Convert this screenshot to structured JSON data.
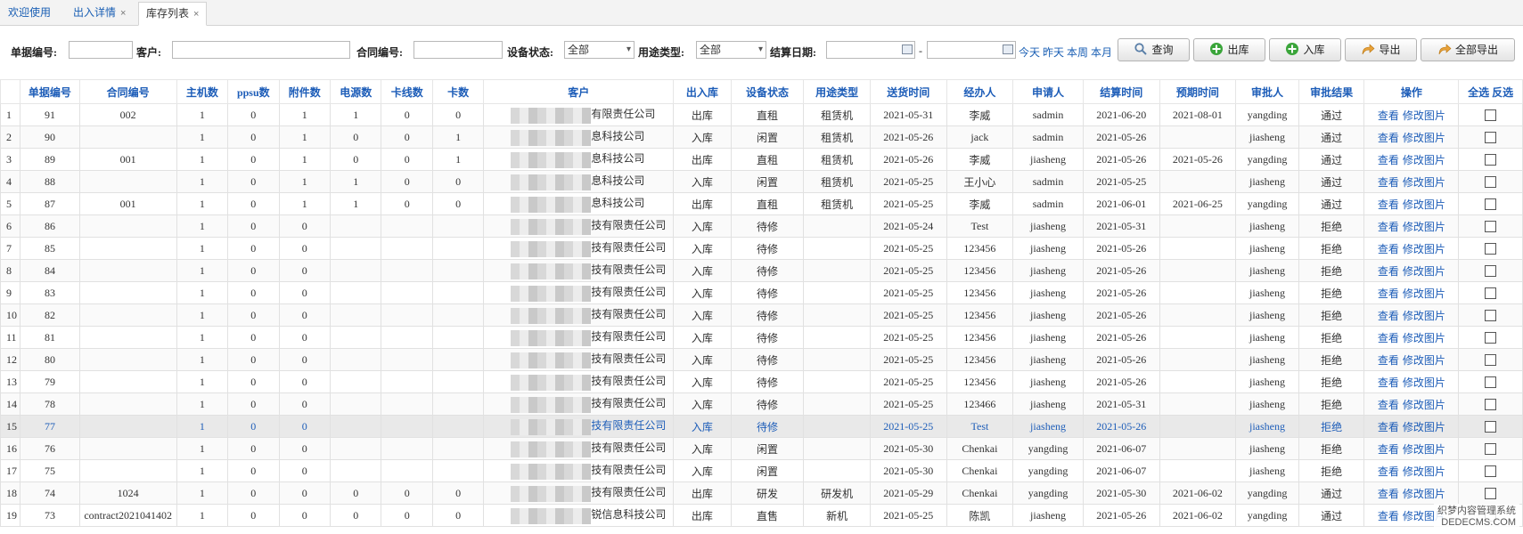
{
  "tabs": [
    {
      "label": "欢迎使用",
      "closable": false
    },
    {
      "label": "出入详情",
      "closable": true
    },
    {
      "label": "库存列表",
      "closable": true,
      "active": true
    }
  ],
  "filters": {
    "doc_no_label": "单据编号:",
    "customer_label": "客户:",
    "contract_no_label": "合同编号:",
    "device_status_label": "设备状态:",
    "device_status_value": "全部",
    "usage_type_label": "用途类型:",
    "usage_type_value": "全部",
    "settle_date_label": "结算日期:",
    "date_sep": "-",
    "quick_today": "今天",
    "quick_yesterday": "昨天",
    "quick_week": "本周",
    "quick_month": "本月"
  },
  "buttons": {
    "query": "查询",
    "outbound": "出库",
    "inbound": "入库",
    "export": "导出",
    "export_all": "全部导出"
  },
  "table": {
    "headers": [
      "单据编号",
      "合同编号",
      "主机数",
      "ppsu数",
      "附件数",
      "电源数",
      "卡线数",
      "卡数",
      "客户",
      "出入库",
      "设备状态",
      "用途类型",
      "送货时间",
      "经办人",
      "申请人",
      "结算时间",
      "预期时间",
      "审批人",
      "审批结果",
      "操作"
    ],
    "select_all": "全选",
    "invert": "反选",
    "view_label": "查看",
    "edit_image_label": "修改图片",
    "rows": [
      {
        "idx": "1",
        "doc": "91",
        "contract": "002",
        "host": "1",
        "ppsu": "0",
        "attach": "1",
        "power": "1",
        "cardline": "0",
        "card": "0",
        "customer": "有限责任公司",
        "io": "出库",
        "status": "直租",
        "usage": "租赁机",
        "delivery": "2021-05-31",
        "handler": "李威",
        "applicant": "sadmin",
        "settle": "2021-06-20",
        "expect": "2021-08-01",
        "approver": "yangding",
        "result": "通过"
      },
      {
        "idx": "2",
        "doc": "90",
        "contract": "",
        "host": "1",
        "ppsu": "0",
        "attach": "1",
        "power": "0",
        "cardline": "0",
        "card": "1",
        "customer": "息科技公司",
        "io": "入库",
        "status": "闲置",
        "usage": "租赁机",
        "delivery": "2021-05-26",
        "handler": "jack",
        "applicant": "sadmin",
        "settle": "2021-05-26",
        "expect": "",
        "approver": "jiasheng",
        "result": "通过"
      },
      {
        "idx": "3",
        "doc": "89",
        "contract": "001",
        "host": "1",
        "ppsu": "0",
        "attach": "1",
        "power": "0",
        "cardline": "0",
        "card": "1",
        "customer": "息科技公司",
        "io": "出库",
        "status": "直租",
        "usage": "租赁机",
        "delivery": "2021-05-26",
        "handler": "李威",
        "applicant": "jiasheng",
        "settle": "2021-05-26",
        "expect": "2021-05-26",
        "approver": "yangding",
        "result": "通过"
      },
      {
        "idx": "4",
        "doc": "88",
        "contract": "",
        "host": "1",
        "ppsu": "0",
        "attach": "1",
        "power": "1",
        "cardline": "0",
        "card": "0",
        "customer": "息科技公司",
        "io": "入库",
        "status": "闲置",
        "usage": "租赁机",
        "delivery": "2021-05-25",
        "handler": "王小心",
        "applicant": "sadmin",
        "settle": "2021-05-25",
        "expect": "",
        "approver": "jiasheng",
        "result": "通过"
      },
      {
        "idx": "5",
        "doc": "87",
        "contract": "001",
        "host": "1",
        "ppsu": "0",
        "attach": "1",
        "power": "1",
        "cardline": "0",
        "card": "0",
        "customer": "息科技公司",
        "io": "出库",
        "status": "直租",
        "usage": "租赁机",
        "delivery": "2021-05-25",
        "handler": "李威",
        "applicant": "sadmin",
        "settle": "2021-06-01",
        "expect": "2021-06-25",
        "approver": "yangding",
        "result": "通过"
      },
      {
        "idx": "6",
        "doc": "86",
        "contract": "",
        "host": "1",
        "ppsu": "0",
        "attach": "0",
        "power": "",
        "cardline": "",
        "card": "",
        "customer": "技有限责任公司",
        "io": "入库",
        "status": "待修",
        "usage": "",
        "delivery": "2021-05-24",
        "handler": "Test",
        "applicant": "jiasheng",
        "settle": "2021-05-31",
        "expect": "",
        "approver": "jiasheng",
        "result": "拒绝"
      },
      {
        "idx": "7",
        "doc": "85",
        "contract": "",
        "host": "1",
        "ppsu": "0",
        "attach": "0",
        "power": "",
        "cardline": "",
        "card": "",
        "customer": "技有限责任公司",
        "io": "入库",
        "status": "待修",
        "usage": "",
        "delivery": "2021-05-25",
        "handler": "123456",
        "applicant": "jiasheng",
        "settle": "2021-05-26",
        "expect": "",
        "approver": "jiasheng",
        "result": "拒绝"
      },
      {
        "idx": "8",
        "doc": "84",
        "contract": "",
        "host": "1",
        "ppsu": "0",
        "attach": "0",
        "power": "",
        "cardline": "",
        "card": "",
        "customer": "技有限责任公司",
        "io": "入库",
        "status": "待修",
        "usage": "",
        "delivery": "2021-05-25",
        "handler": "123456",
        "applicant": "jiasheng",
        "settle": "2021-05-26",
        "expect": "",
        "approver": "jiasheng",
        "result": "拒绝"
      },
      {
        "idx": "9",
        "doc": "83",
        "contract": "",
        "host": "1",
        "ppsu": "0",
        "attach": "0",
        "power": "",
        "cardline": "",
        "card": "",
        "customer": "技有限责任公司",
        "io": "入库",
        "status": "待修",
        "usage": "",
        "delivery": "2021-05-25",
        "handler": "123456",
        "applicant": "jiasheng",
        "settle": "2021-05-26",
        "expect": "",
        "approver": "jiasheng",
        "result": "拒绝"
      },
      {
        "idx": "10",
        "doc": "82",
        "contract": "",
        "host": "1",
        "ppsu": "0",
        "attach": "0",
        "power": "",
        "cardline": "",
        "card": "",
        "customer": "技有限责任公司",
        "io": "入库",
        "status": "待修",
        "usage": "",
        "delivery": "2021-05-25",
        "handler": "123456",
        "applicant": "jiasheng",
        "settle": "2021-05-26",
        "expect": "",
        "approver": "jiasheng",
        "result": "拒绝"
      },
      {
        "idx": "11",
        "doc": "81",
        "contract": "",
        "host": "1",
        "ppsu": "0",
        "attach": "0",
        "power": "",
        "cardline": "",
        "card": "",
        "customer": "技有限责任公司",
        "io": "入库",
        "status": "待修",
        "usage": "",
        "delivery": "2021-05-25",
        "handler": "123456",
        "applicant": "jiasheng",
        "settle": "2021-05-26",
        "expect": "",
        "approver": "jiasheng",
        "result": "拒绝"
      },
      {
        "idx": "12",
        "doc": "80",
        "contract": "",
        "host": "1",
        "ppsu": "0",
        "attach": "0",
        "power": "",
        "cardline": "",
        "card": "",
        "customer": "技有限责任公司",
        "io": "入库",
        "status": "待修",
        "usage": "",
        "delivery": "2021-05-25",
        "handler": "123456",
        "applicant": "jiasheng",
        "settle": "2021-05-26",
        "expect": "",
        "approver": "jiasheng",
        "result": "拒绝"
      },
      {
        "idx": "13",
        "doc": "79",
        "contract": "",
        "host": "1",
        "ppsu": "0",
        "attach": "0",
        "power": "",
        "cardline": "",
        "card": "",
        "customer": "技有限责任公司",
        "io": "入库",
        "status": "待修",
        "usage": "",
        "delivery": "2021-05-25",
        "handler": "123456",
        "applicant": "jiasheng",
        "settle": "2021-05-26",
        "expect": "",
        "approver": "jiasheng",
        "result": "拒绝"
      },
      {
        "idx": "14",
        "doc": "78",
        "contract": "",
        "host": "1",
        "ppsu": "0",
        "attach": "0",
        "power": "",
        "cardline": "",
        "card": "",
        "customer": "技有限责任公司",
        "io": "入库",
        "status": "待修",
        "usage": "",
        "delivery": "2021-05-25",
        "handler": "123466",
        "applicant": "jiasheng",
        "settle": "2021-05-31",
        "expect": "",
        "approver": "jiasheng",
        "result": "拒绝"
      },
      {
        "idx": "15",
        "doc": "77",
        "contract": "",
        "host": "1",
        "ppsu": "0",
        "attach": "0",
        "power": "",
        "cardline": "",
        "card": "",
        "customer": "技有限责任公司",
        "io": "入库",
        "status": "待修",
        "usage": "",
        "delivery": "2021-05-25",
        "handler": "Test",
        "applicant": "jiasheng",
        "settle": "2021-05-26",
        "expect": "",
        "approver": "jiasheng",
        "result": "拒绝",
        "selected": true
      },
      {
        "idx": "16",
        "doc": "76",
        "contract": "",
        "host": "1",
        "ppsu": "0",
        "attach": "0",
        "power": "",
        "cardline": "",
        "card": "",
        "customer": "技有限责任公司",
        "io": "入库",
        "status": "闲置",
        "usage": "",
        "delivery": "2021-05-30",
        "handler": "Chenkai",
        "applicant": "yangding",
        "settle": "2021-06-07",
        "expect": "",
        "approver": "jiasheng",
        "result": "拒绝"
      },
      {
        "idx": "17",
        "doc": "75",
        "contract": "",
        "host": "1",
        "ppsu": "0",
        "attach": "0",
        "power": "",
        "cardline": "",
        "card": "",
        "customer": "技有限责任公司",
        "io": "入库",
        "status": "闲置",
        "usage": "",
        "delivery": "2021-05-30",
        "handler": "Chenkai",
        "applicant": "yangding",
        "settle": "2021-06-07",
        "expect": "",
        "approver": "jiasheng",
        "result": "拒绝"
      },
      {
        "idx": "18",
        "doc": "74",
        "contract": "1024",
        "host": "1",
        "ppsu": "0",
        "attach": "0",
        "power": "0",
        "cardline": "0",
        "card": "0",
        "customer": "技有限责任公司",
        "io": "出库",
        "status": "研发",
        "usage": "研发机",
        "delivery": "2021-05-29",
        "handler": "Chenkai",
        "applicant": "yangding",
        "settle": "2021-05-30",
        "expect": "2021-06-02",
        "approver": "yangding",
        "result": "通过"
      },
      {
        "idx": "19",
        "doc": "73",
        "contract": "contract2021041402",
        "host": "1",
        "ppsu": "0",
        "attach": "0",
        "power": "0",
        "cardline": "0",
        "card": "0",
        "customer": "锐信息科技公司",
        "io": "出库",
        "status": "直售",
        "usage": "新机",
        "delivery": "2021-05-25",
        "handler": "陈凯",
        "applicant": "jiasheng",
        "settle": "2021-05-26",
        "expect": "2021-06-02",
        "approver": "yangding",
        "result": "通过"
      }
    ]
  },
  "watermark": {
    "line1": "织梦内容管理系统",
    "line2": "DEDECMS.COM"
  }
}
